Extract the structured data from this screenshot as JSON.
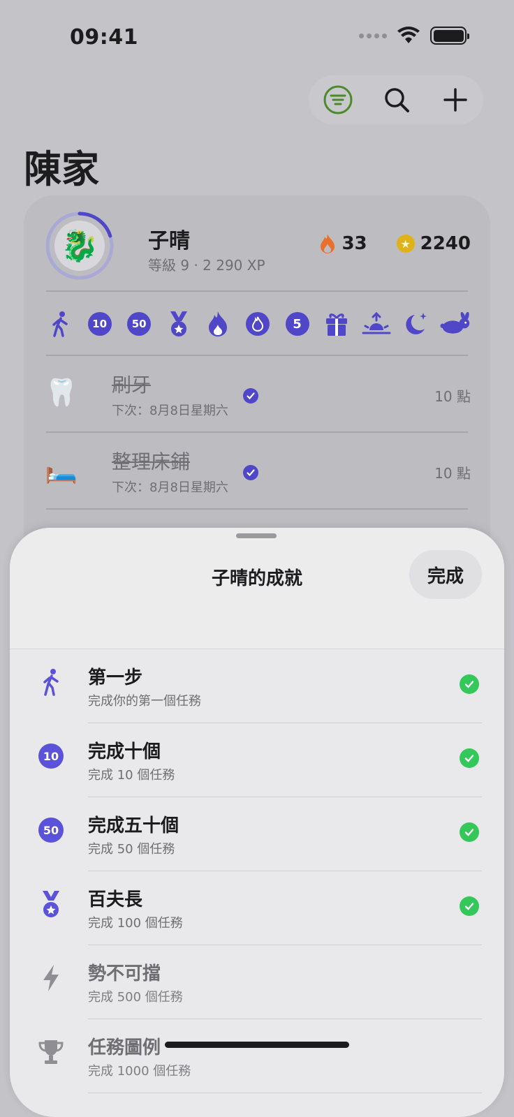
{
  "status_bar": {
    "time": "09:41"
  },
  "page": {
    "title": "陳家"
  },
  "member": {
    "name": "子晴",
    "subtitle": "等級 9 · 2 290 XP",
    "streak": "33",
    "coins": "2240",
    "level_progress": 0.2
  },
  "badges": [
    "walking-figure",
    "10",
    "50",
    "medal",
    "flame",
    "flame-circle",
    "5",
    "gift",
    "sunrise",
    "moon-stars",
    "rabbit"
  ],
  "tasks": [
    {
      "emoji": "🦷",
      "title": "刷牙",
      "subtitle": "下次：8月8日星期六",
      "points": "10 點"
    },
    {
      "emoji": "🛏️",
      "title": "整理床鋪",
      "subtitle": "下次：8月8日星期六",
      "points": "10 點"
    }
  ],
  "sheet": {
    "title": "子晴的成就",
    "done_label": "完成",
    "achievements": [
      {
        "title": "第一步",
        "subtitle": "完成你的第一個任務",
        "icon": "walking-figure-icon",
        "done": true
      },
      {
        "title": "完成十個",
        "subtitle": "完成 10 個任務",
        "icon_text": "10",
        "done": true
      },
      {
        "title": "完成五十個",
        "subtitle": "完成 50 個任務",
        "icon_text": "50",
        "done": true
      },
      {
        "title": "百夫長",
        "subtitle": "完成 100 個任務",
        "icon": "medal-icon",
        "done": true
      },
      {
        "title": "勢不可擋",
        "subtitle": "完成 500 個任務",
        "icon": "bolt-icon",
        "done": false
      },
      {
        "title": "任務圖例",
        "subtitle": "完成 1000 個任務",
        "icon": "trophy-icon",
        "done": false
      }
    ]
  },
  "colors": {
    "accent": "#4f46c8",
    "achievement_accent": "#5a52d8",
    "check_green": "#34c759",
    "filter_green": "#4a8a2a",
    "streak_orange": "#e8702a",
    "coin_gold": "#e0b21a"
  }
}
